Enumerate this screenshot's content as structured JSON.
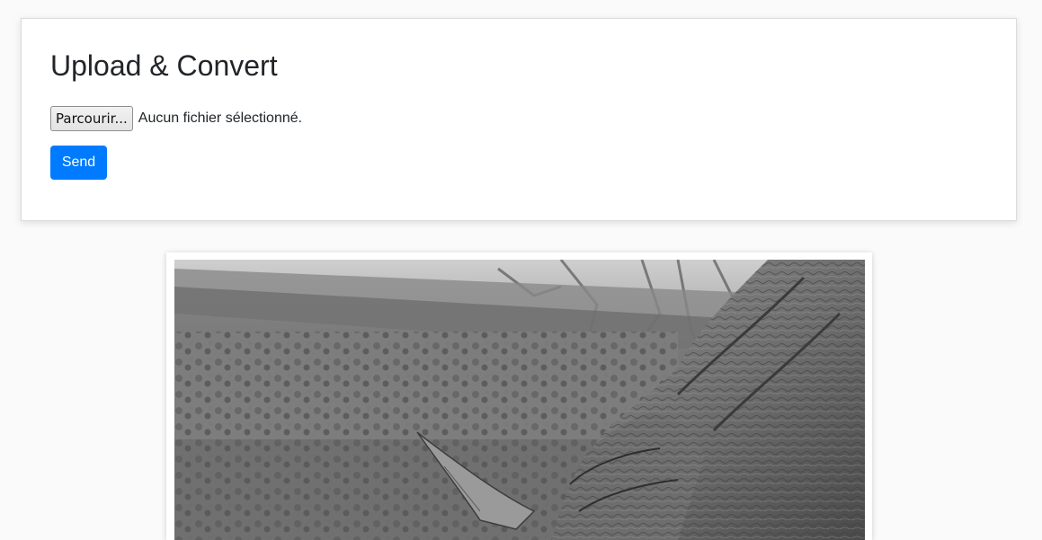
{
  "upload": {
    "title": "Upload & Convert",
    "browse_label": "Parcourir...",
    "file_status": "Aucun fichier sélectionné.",
    "send_label": "Send"
  },
  "colors": {
    "primary": "#007bff",
    "background": "#fafafa"
  },
  "result": {
    "image_description_icon": "rhino-photo-grayscale"
  }
}
